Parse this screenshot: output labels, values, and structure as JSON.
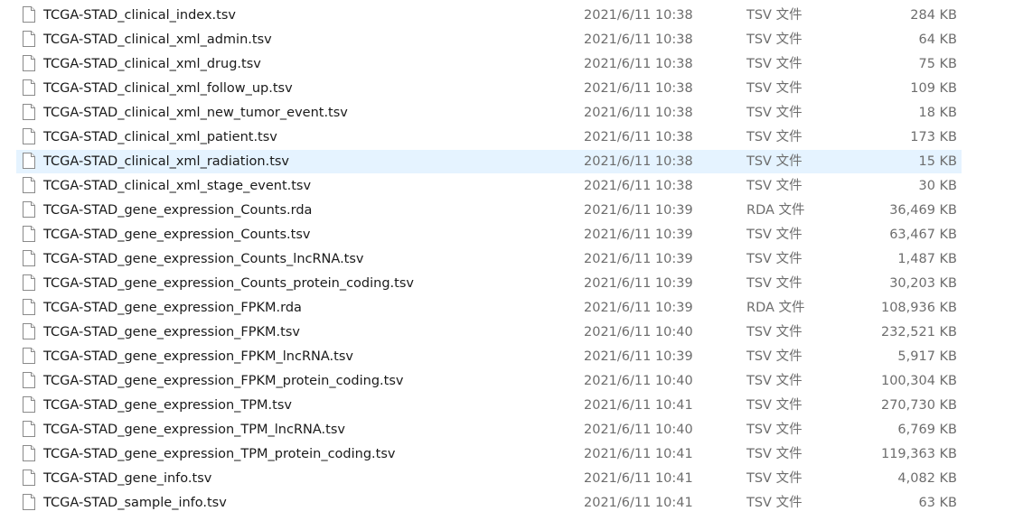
{
  "icons": {
    "file_icon": "generic-document-icon"
  },
  "colors": {
    "selection_background": "#e5f3ff",
    "name_text": "#1a1a1a",
    "detail_text": "#6d6d6d"
  },
  "files": [
    {
      "name": "TCGA-STAD_clinical_index.tsv",
      "date": "2021/6/11 10:38",
      "type": "TSV 文件",
      "size": "284 KB",
      "selected": false
    },
    {
      "name": "TCGA-STAD_clinical_xml_admin.tsv",
      "date": "2021/6/11 10:38",
      "type": "TSV 文件",
      "size": "64 KB",
      "selected": false
    },
    {
      "name": "TCGA-STAD_clinical_xml_drug.tsv",
      "date": "2021/6/11 10:38",
      "type": "TSV 文件",
      "size": "75 KB",
      "selected": false
    },
    {
      "name": "TCGA-STAD_clinical_xml_follow_up.tsv",
      "date": "2021/6/11 10:38",
      "type": "TSV 文件",
      "size": "109 KB",
      "selected": false
    },
    {
      "name": "TCGA-STAD_clinical_xml_new_tumor_event.tsv",
      "date": "2021/6/11 10:38",
      "type": "TSV 文件",
      "size": "18 KB",
      "selected": false
    },
    {
      "name": "TCGA-STAD_clinical_xml_patient.tsv",
      "date": "2021/6/11 10:38",
      "type": "TSV 文件",
      "size": "173 KB",
      "selected": false
    },
    {
      "name": "TCGA-STAD_clinical_xml_radiation.tsv",
      "date": "2021/6/11 10:38",
      "type": "TSV 文件",
      "size": "15 KB",
      "selected": true
    },
    {
      "name": "TCGA-STAD_clinical_xml_stage_event.tsv",
      "date": "2021/6/11 10:38",
      "type": "TSV 文件",
      "size": "30 KB",
      "selected": false
    },
    {
      "name": "TCGA-STAD_gene_expression_Counts.rda",
      "date": "2021/6/11 10:39",
      "type": "RDA 文件",
      "size": "36,469 KB",
      "selected": false
    },
    {
      "name": "TCGA-STAD_gene_expression_Counts.tsv",
      "date": "2021/6/11 10:39",
      "type": "TSV 文件",
      "size": "63,467 KB",
      "selected": false
    },
    {
      "name": "TCGA-STAD_gene_expression_Counts_lncRNA.tsv",
      "date": "2021/6/11 10:39",
      "type": "TSV 文件",
      "size": "1,487 KB",
      "selected": false
    },
    {
      "name": "TCGA-STAD_gene_expression_Counts_protein_coding.tsv",
      "date": "2021/6/11 10:39",
      "type": "TSV 文件",
      "size": "30,203 KB",
      "selected": false
    },
    {
      "name": "TCGA-STAD_gene_expression_FPKM.rda",
      "date": "2021/6/11 10:39",
      "type": "RDA 文件",
      "size": "108,936 KB",
      "selected": false
    },
    {
      "name": "TCGA-STAD_gene_expression_FPKM.tsv",
      "date": "2021/6/11 10:40",
      "type": "TSV 文件",
      "size": "232,521 KB",
      "selected": false
    },
    {
      "name": "TCGA-STAD_gene_expression_FPKM_lncRNA.tsv",
      "date": "2021/6/11 10:39",
      "type": "TSV 文件",
      "size": "5,917 KB",
      "selected": false
    },
    {
      "name": "TCGA-STAD_gene_expression_FPKM_protein_coding.tsv",
      "date": "2021/6/11 10:40",
      "type": "TSV 文件",
      "size": "100,304 KB",
      "selected": false
    },
    {
      "name": "TCGA-STAD_gene_expression_TPM.tsv",
      "date": "2021/6/11 10:41",
      "type": "TSV 文件",
      "size": "270,730 KB",
      "selected": false
    },
    {
      "name": "TCGA-STAD_gene_expression_TPM_lncRNA.tsv",
      "date": "2021/6/11 10:40",
      "type": "TSV 文件",
      "size": "6,769 KB",
      "selected": false
    },
    {
      "name": "TCGA-STAD_gene_expression_TPM_protein_coding.tsv",
      "date": "2021/6/11 10:41",
      "type": "TSV 文件",
      "size": "119,363 KB",
      "selected": false
    },
    {
      "name": "TCGA-STAD_gene_info.tsv",
      "date": "2021/6/11 10:41",
      "type": "TSV 文件",
      "size": "4,082 KB",
      "selected": false
    },
    {
      "name": "TCGA-STAD_sample_info.tsv",
      "date": "2021/6/11 10:41",
      "type": "TSV 文件",
      "size": "63 KB",
      "selected": false
    }
  ]
}
